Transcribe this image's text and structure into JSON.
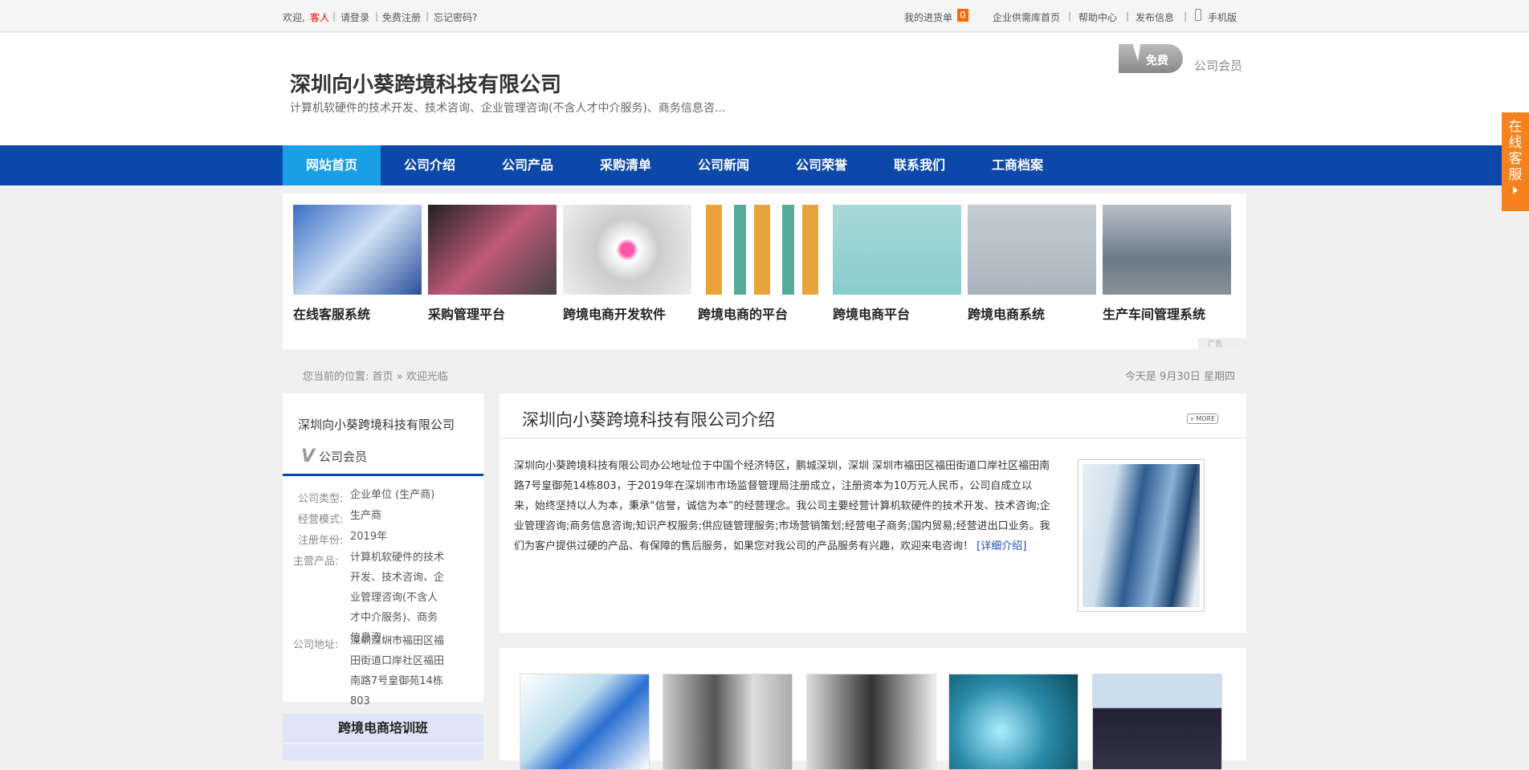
{
  "topbar": {
    "welcome": "欢迎,",
    "guest": "客人",
    "login": "请登录",
    "register": "免费注册",
    "forgot": "忘记密码?",
    "cart": "我的进货单",
    "cart_count": "0",
    "supply_home": "企业供需库首页",
    "help": "帮助中心",
    "publish": "发布信息",
    "mobile": "手机版"
  },
  "header": {
    "company": "深圳向小葵跨境科技有限公司",
    "business": "计算机软硬件的技术开发、技术咨询、企业管理咨询(不含人才中介服务)、商务信息咨...",
    "badge": "免费",
    "member": "公司会员"
  },
  "nav": [
    "网站首页",
    "公司介绍",
    "公司产品",
    "采购清单",
    "公司新闻",
    "公司荣誉",
    "联系我们",
    "工商档案"
  ],
  "banner": {
    "items": [
      "在线客服系统",
      "采购管理平台",
      "跨境电商开发软件",
      "跨境电商的平台",
      "跨境电商平台",
      "跨境电商系统",
      "生产车间管理系统"
    ],
    "ad": "广告"
  },
  "breadcrumb": {
    "label": "您当前的位置:",
    "home": "首页",
    "sep": "»",
    "current": "欢迎光临"
  },
  "date": "今天是 9月30日 星期四",
  "sidebar": {
    "company": "深圳向小葵跨境科技有限公司",
    "member": "公司会员",
    "fields": [
      {
        "label": "公司类型:",
        "value": "企业单位 (生产商)"
      },
      {
        "label": "经营模式:",
        "value": "生产商"
      },
      {
        "label": "注册年份:",
        "value": "2019年"
      },
      {
        "label": "主营产品:",
        "value": "计算机软硬件的技术开发、技术咨询、企业管理咨询(不含人才中介服务)、商务信息咨..."
      },
      {
        "label": "公司地址:",
        "value": "深圳深圳市福田区福田街道口岸社区福田南路7号皇御苑14栋803"
      }
    ],
    "training": "跨境电商培训班"
  },
  "intro": {
    "title": "深圳向小葵跨境科技有限公司介绍",
    "more": "» MORE",
    "text": "深圳向小葵跨境科技有限公司办公地址位于中国个经济特区，鹏城深圳，深圳 深圳市福田区福田街道口岸社区福田南路7号皇御苑14栋803，于2019年在深圳市市场监督管理局注册成立，注册资本为10万元人民币，公司自成立以来，始终坚持以人为本，秉承“信誉，诚信为本”的经营理念。我公司主要经营计算机软硬件的技术开发、技术咨询;企业管理咨询;商务信息咨询;知识产权服务;供应链管理服务;市场营销策划;经营电子商务;国内贸易;经营进出口业务。我们为客户提供过硬的产品、有保障的售后服务，如果您对我公司的产品服务有兴趣，欢迎来电咨询！",
    "detail": "[详细介绍]"
  },
  "service": "在线客服"
}
